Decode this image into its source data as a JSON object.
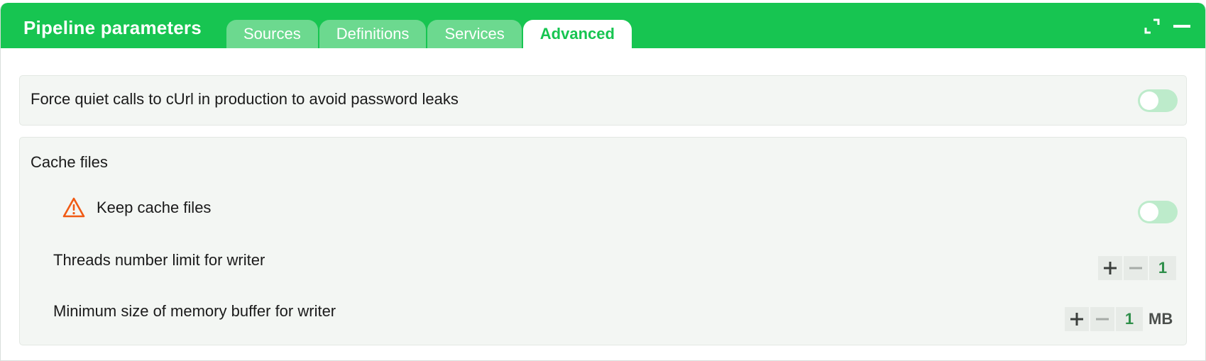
{
  "panel": {
    "title": "Pipeline parameters",
    "tabs": [
      {
        "label": "Sources",
        "active": false
      },
      {
        "label": "Definitions",
        "active": false
      },
      {
        "label": "Services",
        "active": false
      },
      {
        "label": "Advanced",
        "active": true
      }
    ]
  },
  "settings": {
    "quiet_curl": {
      "label": "Force quiet calls to cUrl in production to avoid password leaks",
      "enabled": false
    },
    "cache": {
      "section_label": "Cache files",
      "keep_cache": {
        "label": "Keep cache files",
        "enabled": false,
        "icon": "warning-icon"
      },
      "threads_limit": {
        "label": "Threads number limit for writer",
        "value": "1"
      },
      "memory_buffer": {
        "label": "Minimum size of memory buffer for writer",
        "value": "1",
        "unit": "MB"
      }
    }
  },
  "colors": {
    "header": "#17c551",
    "tab_inactive": "#6cd98f",
    "toggle_off": "#bdebcb",
    "warning": "#f05a14",
    "value_text": "#2f8f4a"
  }
}
